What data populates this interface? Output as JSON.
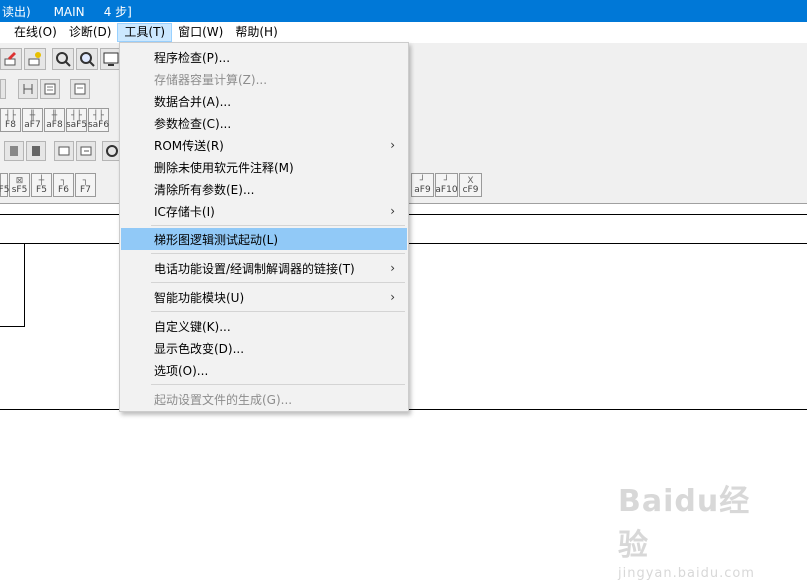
{
  "titlebar": {
    "text": "读出)      MAIN     4 步]"
  },
  "menubar": {
    "items": [
      {
        "label": "在线(O)"
      },
      {
        "label": "诊断(D)"
      },
      {
        "label": "工具(T)"
      },
      {
        "label": "窗口(W)"
      },
      {
        "label": "帮助(H)"
      }
    ]
  },
  "toolbar": {
    "row4_keys": [
      "F8",
      "aF7",
      "aF8",
      "saF5",
      "saF6"
    ],
    "row6_keys": [
      "F5",
      "sF5",
      "F5",
      "F6",
      "F7"
    ],
    "row6_right_keys": [
      "aF9",
      "aF10",
      "cF9"
    ]
  },
  "tools_menu": {
    "items": [
      {
        "label": "程序检查(P)...",
        "enabled": true,
        "submenu": false
      },
      {
        "label": "存储器容量计算(Z)...",
        "enabled": false,
        "submenu": false
      },
      {
        "label": "数据合并(A)...",
        "enabled": true,
        "submenu": false
      },
      {
        "label": "参数检查(C)...",
        "enabled": true,
        "submenu": false
      },
      {
        "label": "ROM传送(R)",
        "enabled": true,
        "submenu": true
      },
      {
        "label": "删除未使用软元件注释(M)",
        "enabled": true,
        "submenu": false
      },
      {
        "label": "清除所有参数(E)...",
        "enabled": true,
        "submenu": false
      },
      {
        "label": "IC存储卡(I)",
        "enabled": true,
        "submenu": true
      },
      {
        "label": "梯形图逻辑测试起动(L)",
        "enabled": true,
        "submenu": false,
        "highlighted": true
      },
      {
        "label": "电话功能设置/经调制解调器的链接(T)",
        "enabled": true,
        "submenu": true
      },
      {
        "label": "智能功能模块(U)",
        "enabled": true,
        "submenu": true
      },
      {
        "label": "自定义键(K)...",
        "enabled": true,
        "submenu": false
      },
      {
        "label": "显示色改变(D)...",
        "enabled": true,
        "submenu": false
      },
      {
        "label": "选项(O)...",
        "enabled": true,
        "submenu": false
      },
      {
        "label": "起动设置文件的生成(G)...",
        "enabled": false,
        "submenu": false
      }
    ],
    "submenu_arrow": "›",
    "highlight_color": "#91c9f7"
  },
  "watermark": {
    "logo": "Baidu经验",
    "url": "jingyan.baidu.com"
  },
  "colors": {
    "titlebar": "#0078d7",
    "toolbar": "#f0f0f0",
    "menu_bg": "#f2f2f2"
  }
}
